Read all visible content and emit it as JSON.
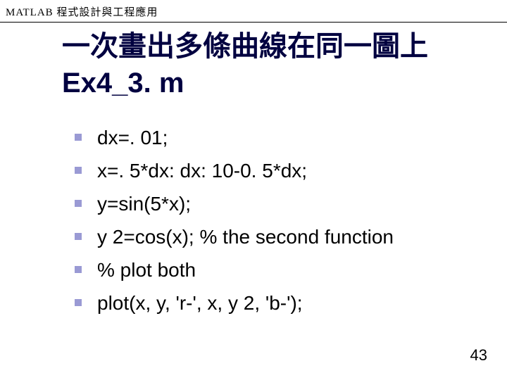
{
  "header": "MATLAB 程式設計與工程應用",
  "title_line1": "一次畫出多條曲線在同一圖上",
  "title_line2": "Ex4_3. m",
  "bullets": [
    "dx=. 01;",
    "x=. 5*dx: dx: 10-0. 5*dx;",
    "y=sin(5*x);",
    "y 2=cos(x); % the second function",
    "% plot both",
    "plot(x, y, 'r-', x, y 2, 'b-');"
  ],
  "page_number": "43"
}
